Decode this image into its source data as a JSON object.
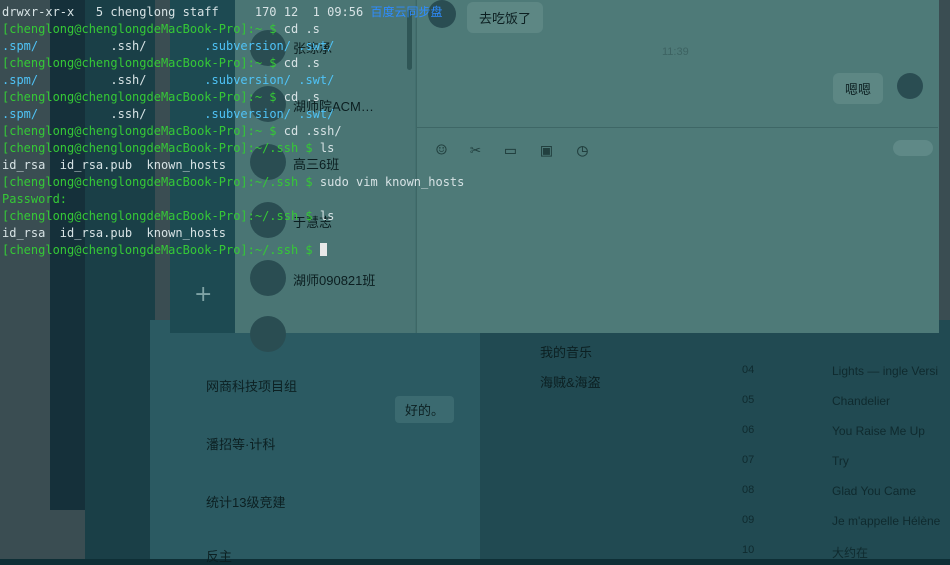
{
  "terminal": {
    "lines": [
      {
        "parts": [
          {
            "t": "drwxr-xr-x   5 chenglong staff     170 12  1 09:56 ",
            "c": "w"
          },
          {
            "t": "百度云同步盘",
            "c": "b"
          }
        ]
      },
      {
        "parts": [
          {
            "t": "[chenglong@chenglongdeMacBook-Pro]:~ $ ",
            "c": "g"
          },
          {
            "t": "cd .s",
            "c": "w"
          }
        ]
      },
      {
        "parts": [
          {
            "t": ".spm/",
            "c": "c"
          },
          {
            "t": "          .ssh/        ",
            "c": "w"
          },
          {
            "t": ".subversion/ .swt/",
            "c": "c"
          }
        ]
      },
      {
        "parts": [
          {
            "t": "[chenglong@chenglongdeMacBook-Pro]:~ $ ",
            "c": "g"
          },
          {
            "t": "cd .s",
            "c": "w"
          }
        ]
      },
      {
        "parts": [
          {
            "t": ".spm/",
            "c": "c"
          },
          {
            "t": "          .ssh/        ",
            "c": "w"
          },
          {
            "t": ".subversion/ .swt/",
            "c": "c"
          }
        ]
      },
      {
        "parts": [
          {
            "t": "[chenglong@chenglongdeMacBook-Pro]:~ $ ",
            "c": "g"
          },
          {
            "t": "cd .s",
            "c": "w"
          }
        ]
      },
      {
        "parts": [
          {
            "t": ".spm/",
            "c": "c"
          },
          {
            "t": "          .ssh/        ",
            "c": "w"
          },
          {
            "t": ".subversion/ .swt/",
            "c": "c"
          }
        ]
      },
      {
        "parts": [
          {
            "t": "[chenglong@chenglongdeMacBook-Pro]:~ $ ",
            "c": "g"
          },
          {
            "t": "cd .ssh/",
            "c": "w"
          }
        ]
      },
      {
        "parts": [
          {
            "t": "[chenglong@chenglongdeMacBook-Pro]:~/.ssh $ ",
            "c": "g"
          },
          {
            "t": "ls",
            "c": "w"
          }
        ]
      },
      {
        "parts": [
          {
            "t": "id_rsa  id_rsa.pub  known_hosts",
            "c": "w"
          }
        ]
      },
      {
        "parts": [
          {
            "t": "[chenglong@chenglongdeMacBook-Pro]:~/.ssh $ ",
            "c": "g"
          },
          {
            "t": "sudo vim known_hosts",
            "c": "w"
          }
        ]
      },
      {
        "parts": [
          {
            "t": "Password:",
            "c": "g"
          }
        ]
      },
      {
        "parts": [
          {
            "t": "[chenglong@chenglongdeMacBook-Pro]:~/.ssh $ ",
            "c": "g"
          },
          {
            "t": "ls",
            "c": "w"
          }
        ]
      },
      {
        "parts": [
          {
            "t": "id_rsa  id_rsa.pub  known_hosts",
            "c": "w"
          }
        ]
      },
      {
        "parts": [
          {
            "t": "[chenglong@chenglongdeMacBook-Pro]:~/.ssh $ ",
            "c": "g"
          },
          {
            "t": "",
            "c": "w"
          }
        ]
      }
    ]
  },
  "wechat": {
    "chats": [
      "张练承",
      "湖师院ACM…",
      "高三6班",
      "于慧志",
      "湖师090821班"
    ],
    "messages": {
      "received": "去吃饭了",
      "time": "11:39",
      "sent": "嗯嗯"
    }
  },
  "wechat_back": {
    "chats": [
      "网商科技项目组",
      "潘招等·计科",
      "统计13级竞建",
      "反主"
    ],
    "msg": "好的。"
  },
  "music": {
    "menu": [
      "我的音乐",
      "海贼&海盗"
    ],
    "songs": [
      {
        "num": "04",
        "title": "Lights — ingle Versi"
      },
      {
        "num": "05",
        "title": "Chandelier"
      },
      {
        "num": "06",
        "title": "You Raise Me Up"
      },
      {
        "num": "07",
        "title": "Try"
      },
      {
        "num": "08",
        "title": "Glad You Came"
      },
      {
        "num": "09",
        "title": "Je m'appelle Hélène"
      },
      {
        "num": "10",
        "title": "大约在"
      }
    ]
  },
  "colors": {
    "prompt": "#35c936",
    "dir": "#4fc3f7",
    "link": "#2e8cff"
  }
}
